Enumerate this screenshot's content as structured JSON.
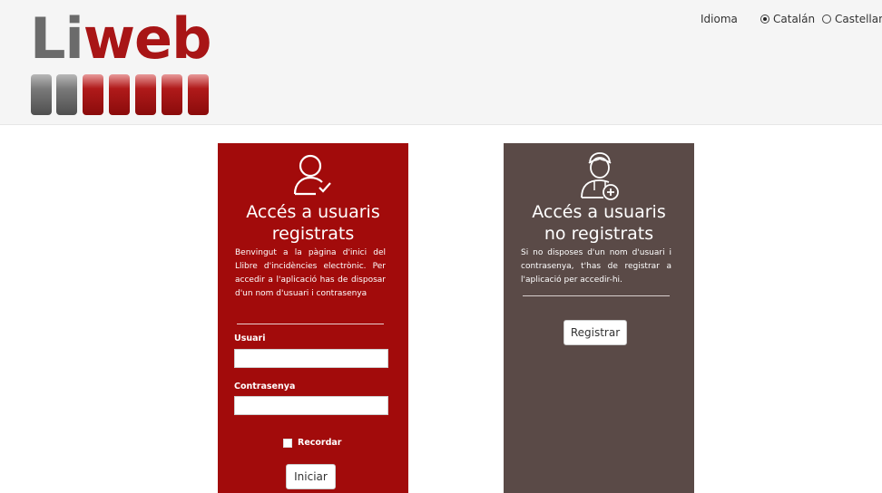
{
  "brand": {
    "logo_part1": "Li",
    "logo_part2": "web",
    "grey": "#6b6b6b",
    "red": "#a81516"
  },
  "language": {
    "label": "Idioma",
    "options": [
      {
        "label": "Catalán",
        "selected": true
      },
      {
        "label": "Castellano",
        "selected": false
      }
    ]
  },
  "registered": {
    "icon": "user-check-icon",
    "title_line1": "Accés a usuaris",
    "title_line2": "registrats",
    "description": "Benvingut a la pàgina d'inici del Llibre d'incidències electrònic. Per accedir a l'aplicació has de disposar d'un nom d'usuari i contrasenya",
    "username_label": "Usuari",
    "username_value": "",
    "password_label": "Contrasenya",
    "password_value": "",
    "remember_label": "Recordar",
    "remember_checked": false,
    "submit_label": "Iniciar",
    "color": "#a20b0b"
  },
  "unregistered": {
    "icon": "user-add-icon",
    "title_line1": "Accés a usuaris",
    "title_line2": "no registrats",
    "description": "Si no disposes d'un nom d'usuari i contrasenya, t'has de registrar a l'aplicació per accedir-hi.",
    "register_label": "Registrar",
    "color": "#5a4a47"
  }
}
